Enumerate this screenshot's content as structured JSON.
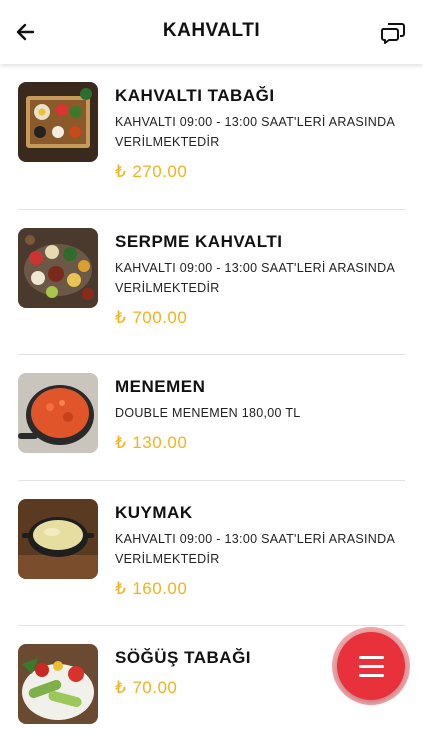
{
  "header": {
    "title": "KAHVALTI",
    "back_icon": "arrow-left-icon",
    "chat_icon": "chat-bubbles-icon"
  },
  "menu": {
    "currency_symbol": "₺",
    "price_color": "#f2b21b",
    "items": [
      {
        "name": "KAHVALTI TABAĞI",
        "description": "KAHVALTI 09:00 - 13:00 SAAT'LERİ ARASINDA VERİLMEKTEDİR",
        "price": "270.00",
        "image": "breakfast-plate-photo"
      },
      {
        "name": "SERPME KAHVALTI",
        "description": "KAHVALTI 09:00 - 13:00 SAAT'LERİ ARASINDA VERİLMEKTEDİR",
        "price": "700.00",
        "image": "spread-breakfast-photo"
      },
      {
        "name": "MENEMEN",
        "description": "DOUBLE MENEMEN 180,00 TL",
        "price": "130.00",
        "image": "menemen-pan-photo"
      },
      {
        "name": "KUYMAK",
        "description": "KAHVALTI 09:00 - 13:00 SAAT'LERİ ARASINDA VERİLMEKTEDİR",
        "price": "160.00",
        "image": "kuymak-pan-photo"
      },
      {
        "name": "SÖĞÜŞ TABAĞI",
        "description": "",
        "price": "70.00",
        "image": "vegetable-plate-photo"
      }
    ]
  },
  "fab": {
    "icon": "hamburger-menu-icon",
    "color": "#e8313a"
  }
}
